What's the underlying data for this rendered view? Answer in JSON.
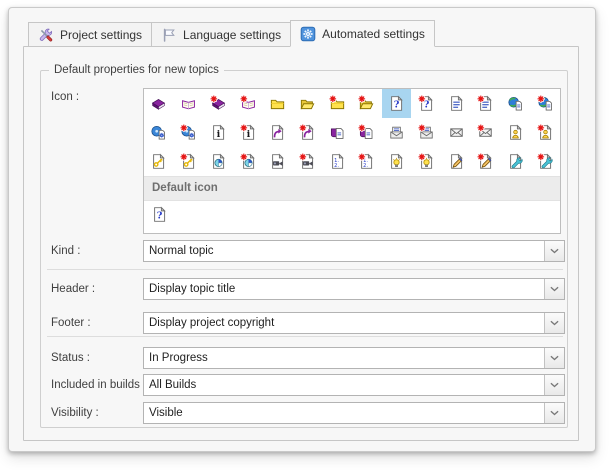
{
  "tabs": [
    {
      "label": "Project settings",
      "icon": "tools-icon",
      "active": false
    },
    {
      "label": "Language settings",
      "icon": "flag-icon",
      "active": false
    },
    {
      "label": "Automated settings",
      "icon": "gear-icon",
      "active": true
    }
  ],
  "group_title": "Default properties for new topics",
  "icon_picker": {
    "label": "Icon :",
    "default_section_label": "Default icon",
    "default_icon": {
      "type": "page-question"
    },
    "rows": [
      [
        {
          "type": "book-closed"
        },
        {
          "type": "book-open"
        },
        {
          "type": "book-closed",
          "new": true
        },
        {
          "type": "book-open",
          "new": true
        },
        {
          "type": "folder"
        },
        {
          "type": "folder-open"
        },
        {
          "type": "folder",
          "new": true
        },
        {
          "type": "folder-open",
          "new": true
        },
        {
          "type": "page-question",
          "selected": true
        },
        {
          "type": "page-question",
          "new": true
        },
        {
          "type": "page-lines"
        },
        {
          "type": "page-lines",
          "new": true
        },
        {
          "type": "globe-page"
        },
        {
          "type": "globe-page",
          "new": true
        }
      ],
      [
        {
          "type": "globe-gear"
        },
        {
          "type": "globe-gear",
          "new": true
        },
        {
          "type": "page-info"
        },
        {
          "type": "page-info",
          "new": true
        },
        {
          "type": "page-arrow"
        },
        {
          "type": "page-arrow",
          "new": true
        },
        {
          "type": "book-page"
        },
        {
          "type": "book-page",
          "new": true
        },
        {
          "type": "mail-open"
        },
        {
          "type": "mail-open",
          "new": true
        },
        {
          "type": "mail"
        },
        {
          "type": "mail",
          "new": true
        },
        {
          "type": "page-person"
        },
        {
          "type": "page-person",
          "new": true
        }
      ],
      [
        {
          "type": "page-key"
        },
        {
          "type": "page-key",
          "new": true
        },
        {
          "type": "page-pie"
        },
        {
          "type": "page-pie",
          "new": true
        },
        {
          "type": "page-camera"
        },
        {
          "type": "page-camera",
          "new": true
        },
        {
          "type": "page-numbers"
        },
        {
          "type": "page-numbers",
          "new": true
        },
        {
          "type": "page-bulb"
        },
        {
          "type": "page-bulb",
          "new": true
        },
        {
          "type": "page-edit"
        },
        {
          "type": "page-edit",
          "new": true
        },
        {
          "type": "page-wrench"
        },
        {
          "type": "page-wrench",
          "new": true
        }
      ]
    ]
  },
  "fields": [
    {
      "id": "kind",
      "label": "Kind :",
      "value": "Normal topic"
    },
    {
      "id": "header",
      "label": "Header :",
      "value": "Display topic title"
    },
    {
      "id": "footer",
      "label": "Footer :",
      "value": "Display project copyright"
    },
    {
      "id": "status",
      "label": "Status :",
      "value": "In Progress"
    },
    {
      "id": "included-in-builds",
      "label": "Included in builds :",
      "value": "All Builds"
    },
    {
      "id": "visibility",
      "label": "Visibility :",
      "value": "Visible"
    }
  ],
  "colors": {
    "selection_highlight": "#a8d5f0",
    "panel_background": "#f7f7f7",
    "border": "#c6c6c6",
    "section_band": "#ececec",
    "new_star": "#e51212",
    "automated_tab_icon": "#4f93dd"
  }
}
